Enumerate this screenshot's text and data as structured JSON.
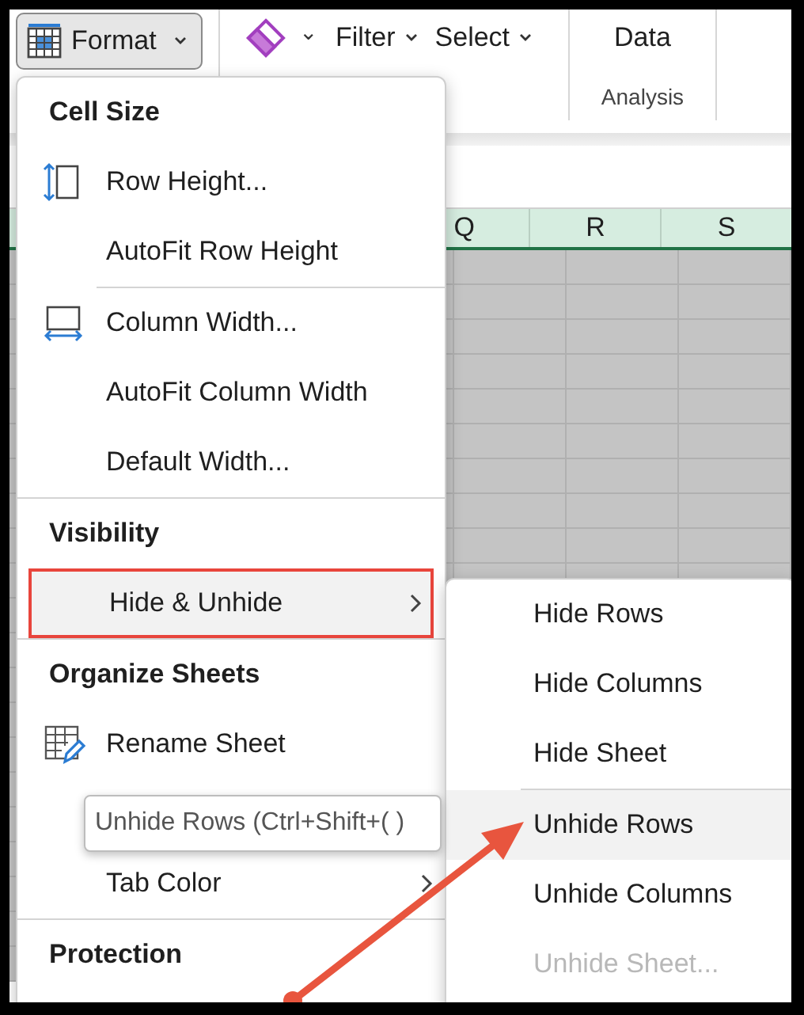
{
  "ribbon": {
    "format_button": {
      "label": "Format",
      "pressed": true
    },
    "clear_caret": "⌄",
    "filter": "Filter",
    "select": "Select",
    "data_button": "Data",
    "group_label": "Analysis"
  },
  "sheet": {
    "columns": [
      "Q",
      "R",
      "S"
    ]
  },
  "format_menu": [
    {
      "kind": "header",
      "label": "Cell Size"
    },
    {
      "kind": "rowheight",
      "label": "Row Height..."
    },
    {
      "kind": "item",
      "label": "AutoFit Row Height"
    },
    {
      "kind": "divider"
    },
    {
      "kind": "colwidth",
      "label": "Column Width..."
    },
    {
      "kind": "item",
      "label": "AutoFit Column Width"
    },
    {
      "kind": "item",
      "label": "Default Width..."
    },
    {
      "kind": "rule"
    },
    {
      "kind": "header",
      "label": "Visibility"
    },
    {
      "kind": "item",
      "label": "Hide & Unhide",
      "submenu": true,
      "highlighted": true
    },
    {
      "kind": "rule"
    },
    {
      "kind": "header",
      "label": "Organize Sheets"
    },
    {
      "kind": "rename",
      "label": "Rename Sheet"
    },
    {
      "kind": "covered"
    },
    {
      "kind": "item",
      "label": "Tab Color",
      "submenu": true
    },
    {
      "kind": "rule"
    },
    {
      "kind": "header",
      "label": "Protection"
    }
  ],
  "submenu": [
    {
      "kind": "item",
      "label": "Hide Rows",
      "hovered": false,
      "disabled": false
    },
    {
      "kind": "item",
      "label": "Hide Columns",
      "hovered": false,
      "disabled": false
    },
    {
      "kind": "item",
      "label": "Hide Sheet",
      "hovered": false,
      "disabled": false
    },
    {
      "kind": "divider"
    },
    {
      "kind": "item",
      "label": "Unhide Rows",
      "hovered": true,
      "disabled": false
    },
    {
      "kind": "item",
      "label": "Unhide Columns",
      "hovered": false,
      "disabled": false
    },
    {
      "kind": "item",
      "label": "Unhide Sheet...",
      "hovered": false,
      "disabled": true
    }
  ],
  "tooltip": "Unhide Rows (Ctrl+Shift+( )"
}
